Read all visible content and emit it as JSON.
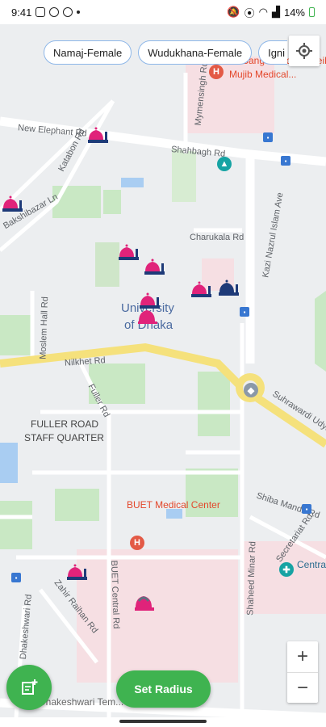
{
  "status": {
    "time": "9:41",
    "battery": "14%"
  },
  "filters": [
    "Namaj-Female",
    "Wudukhana-Female",
    "Igni"
  ],
  "map": {
    "labels": {
      "new_elephant": "New Elephant Rd",
      "shahbagh": "Shahbagh Rd",
      "katabon": "Katabon Rd",
      "nilkhet": "Nilkhet Rd",
      "fuller": "Fuller Rd",
      "chankala": "Charukala Rd",
      "kazi": "Kazi Nazrul Islam Ave",
      "moslem_hall": "Moslem Hall Rd",
      "suhrawardi": "Suhrawardi Udyan Rd",
      "shiba_mandir": "Shiba Mandir Rd",
      "secretariat": "Secretariat Rd",
      "shaheed_minar": "Shaheed Minar Rd",
      "buet_central": "BUET Central Rd",
      "zahir_raihan": "Zahir Raihan Rd",
      "dhakeshwari": "Dhakeshwari Rd",
      "mymensingh": "Mymensingh Rd",
      "bakshi": "Bakshibazar Ln",
      "university_line1": "University",
      "university_line2": "of Dhaka",
      "fuller_quarter_line1": "FULLER ROAD",
      "fuller_quarter_line2": "STAFF QUARTER",
      "buet_medical": "BUET Medical Center",
      "mujib_medical": "Mujib Medical...",
      "bangabandhu": "Bangabandhu Sheikh",
      "centra": "Centra",
      "dhakeshwari_temple": "Dhakeshwari Tem..."
    }
  },
  "controls": {
    "set_radius": "Set Radius",
    "zoom_in": "+",
    "zoom_out": "−"
  },
  "colors": {
    "accent": "#3fb350",
    "mosque_female": "#e0237a",
    "mosque_male": "#1e3a78",
    "road_major": "#f5e17c"
  }
}
